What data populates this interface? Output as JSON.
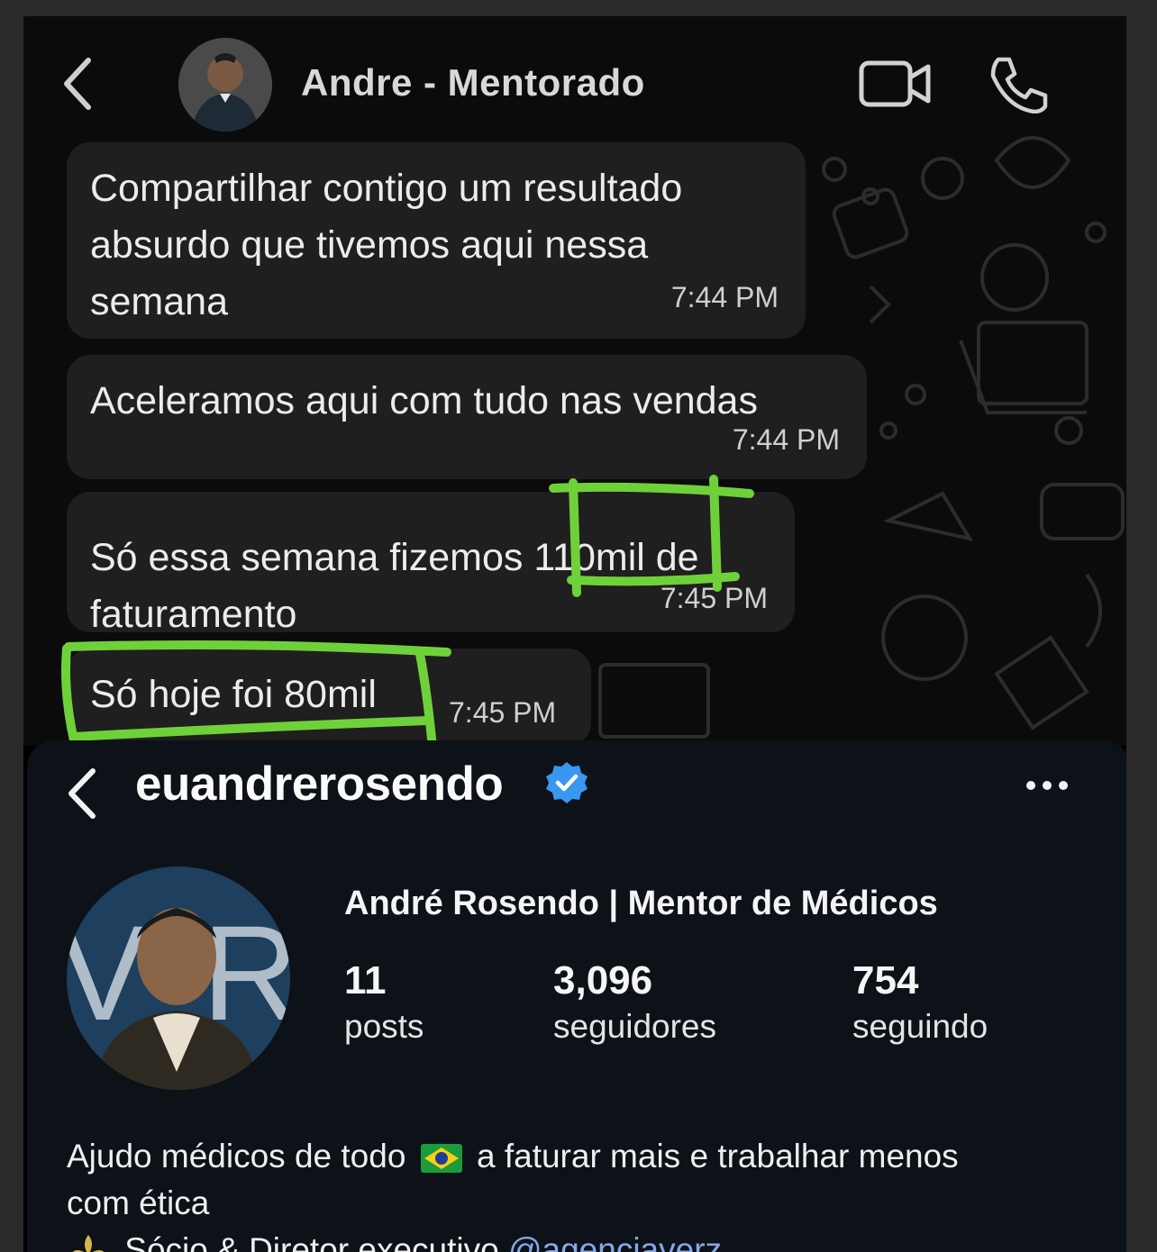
{
  "chat": {
    "contact_name": "Andre - Mentorado",
    "messages": [
      {
        "text": "Compartilhar contigo um resultado\nabsurdo que tivemos aqui nessa\nsemana",
        "time": "7:44 PM"
      },
      {
        "text": "Aceleramos aqui com tudo nas vendas",
        "time": "7:44 PM"
      },
      {
        "text": "Só essa semana fizemos 110mil de\nfaturamento",
        "time": "7:45 PM"
      },
      {
        "text": "Só hoje foi 80mil",
        "time": "7:45 PM"
      }
    ],
    "highlight_color": "#6fd13a"
  },
  "instagram": {
    "username": "euandrerosendo",
    "display_name": "André Rosendo | Mentor de Médicos",
    "stats": [
      {
        "value": "11",
        "label": "posts"
      },
      {
        "value": "3,096",
        "label": "seguidores"
      },
      {
        "value": "754",
        "label": "seguindo"
      }
    ],
    "bio_line1_a": "Ajudo médicos de todo",
    "bio_line1_b": "a faturar mais e trabalhar menos",
    "bio_line2": "com ética",
    "bio_line3_text": "Sócio & Diretor executivo",
    "bio_line3_mention": "@agenciaverz",
    "verified_color": "#3897f0"
  }
}
